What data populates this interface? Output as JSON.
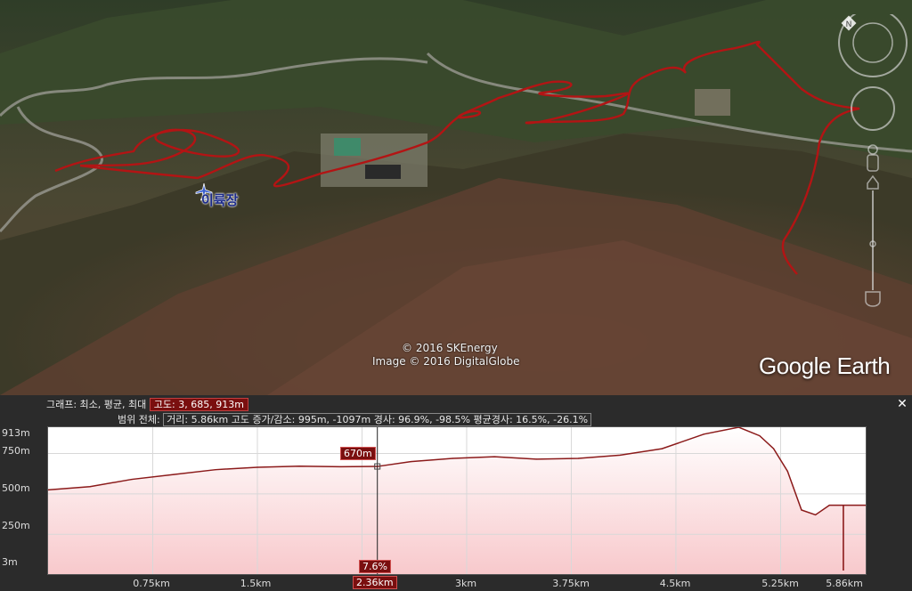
{
  "map": {
    "place_label": "이륙장",
    "credit_line1": "© 2016 SKEnergy",
    "credit_line2": "Image © 2016 DigitalGlobe",
    "logo": "Google Earth",
    "icons": [
      "airplane-icon",
      "north-arrow-icon",
      "look-joystick-icon",
      "move-joystick-icon",
      "street-view-pegman-icon",
      "zoom-slider-icon"
    ],
    "track_color": "#b31414"
  },
  "profile": {
    "legend_line1_prefix": "그래프: 최소, 평균, 최대",
    "legend_line1_value": "고도: 3, 685, 913m",
    "legend_line2_prefix": "범위 전체:",
    "legend_line2_value": "거리: 5.86km 고도 증가/감소: 995m, -1097m 경사: 96.9%, -98.5% 평균경사: 16.5%, -26.1%",
    "close_label": "✕",
    "cursor_elevation": "670m",
    "cursor_slope": "7.6%",
    "cursor_distance": "2.36km",
    "y_ticks": [
      "913m",
      "750m",
      "500m",
      "250m",
      "3m"
    ],
    "x_ticks": [
      "0.75km",
      "1.5km",
      "3km",
      "3.75km",
      "4.5km",
      "5.25km",
      "5.86km"
    ],
    "fill_color": "#f8c9cc",
    "line_color": "#8b1a1a"
  },
  "chart_data": {
    "type": "area",
    "x": [
      0,
      0.3,
      0.6,
      0.9,
      1.2,
      1.5,
      1.8,
      2.1,
      2.36,
      2.6,
      2.9,
      3.2,
      3.5,
      3.8,
      4.1,
      4.4,
      4.7,
      4.95,
      5.1,
      5.2,
      5.3,
      5.4,
      5.5,
      5.6,
      5.7,
      5.86
    ],
    "values": [
      525,
      545,
      590,
      620,
      650,
      665,
      672,
      668,
      670,
      700,
      720,
      730,
      715,
      720,
      740,
      780,
      870,
      913,
      860,
      780,
      640,
      400,
      370,
      430,
      430,
      430
    ],
    "xlabel": "",
    "ylabel": "",
    "xlim": [
      0,
      5.86
    ],
    "ylim": [
      3,
      913
    ],
    "grid": true
  }
}
